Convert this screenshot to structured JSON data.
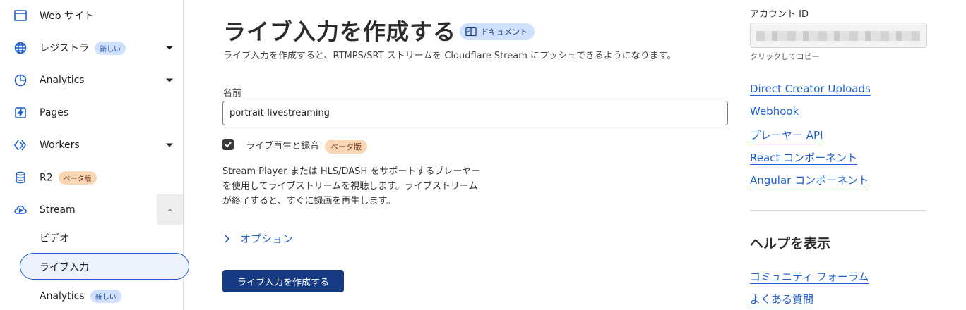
{
  "sidebar": {
    "items": [
      {
        "label": "Web サイト",
        "icon": "browser-window-icon",
        "badge": null,
        "has_caret": false
      },
      {
        "label": "レジストラ",
        "icon": "globe-icon",
        "badge": "新しい",
        "has_caret": true
      },
      {
        "label": "Analytics",
        "icon": "pie-chart-icon",
        "badge": null,
        "has_caret": true
      },
      {
        "label": "Pages",
        "icon": "bolt-page-icon",
        "badge": null,
        "has_caret": false
      },
      {
        "label": "Workers",
        "icon": "workers-diamond-icon",
        "badge": null,
        "has_caret": true
      },
      {
        "label": "R2",
        "icon": "database-icon",
        "badge": "ベータ版",
        "has_caret": false
      },
      {
        "label": "Stream",
        "icon": "cloud-play-icon",
        "badge": null,
        "has_caret": false
      }
    ],
    "stream_sub": {
      "video": "ビデオ",
      "live_input": "ライブ入力",
      "analytics": "Analytics",
      "analytics_badge": "新しい"
    }
  },
  "main": {
    "title": "ライブ入力を作成する",
    "doc_badge": "ドキュメント",
    "subtitle": "ライブ入力を作成すると、RTMPS/SRT ストリームを Cloudflare Stream にプッシュできるようになります。",
    "name_label": "名前",
    "name_value": "portrait-livestreaming",
    "checkbox_label": "ライブ再生と録音",
    "checkbox_badge": "ベータ版",
    "checkbox_checked": true,
    "description": "Stream Player または HLS/DASH をサポートするプレーヤーを使用してライブストリームを視聴します。ライブストリームが終了すると、すぐに録画を再生します。",
    "options_label": "オプション",
    "create_button": "ライブ入力を作成する"
  },
  "right": {
    "account_label": "アカウント ID",
    "copy_hint": "クリックしてコピー",
    "links": [
      "Direct Creator Uploads",
      "Webhook",
      "プレーヤー API",
      "React コンポーネント",
      "Angular コンポーネント"
    ],
    "help_title": "ヘルプを表示",
    "help_links": [
      "コミュニティ フォーラム",
      "よくある質問"
    ]
  },
  "colors": {
    "accent": "#1f5fd1",
    "primary_button": "#173b82",
    "badge_blue": "#cfe1ff",
    "badge_orange": "#fbd6b5"
  }
}
